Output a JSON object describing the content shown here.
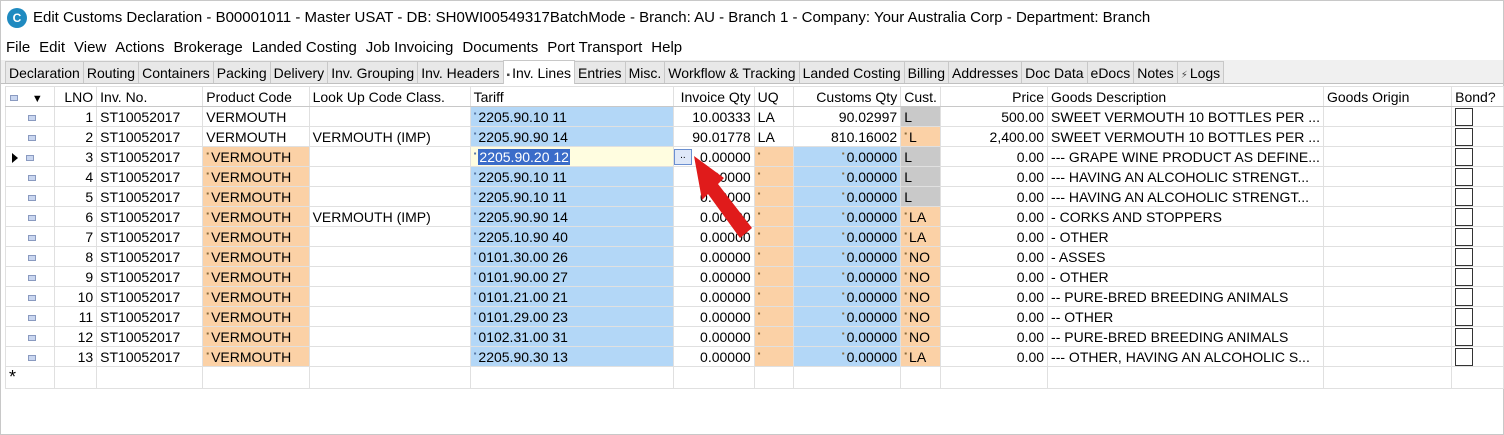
{
  "window": {
    "title": "Edit Customs Declaration - B00001011 - Master USAT - DB: SH0WI00549317BatchMode - Branch: AU - Branch 1 - Company: Your Australia Corp - Department: Branch",
    "app_icon_letter": "C"
  },
  "menu": [
    "File",
    "Edit",
    "View",
    "Actions",
    "Brokerage",
    "Landed Costing",
    "Job Invoicing",
    "Documents",
    "Port Transport",
    "Help"
  ],
  "tabs": [
    {
      "label": "Declaration",
      "active": false
    },
    {
      "label": "Routing",
      "active": false
    },
    {
      "label": "Containers",
      "active": false
    },
    {
      "label": "Packing",
      "active": false
    },
    {
      "label": "Delivery",
      "active": false
    },
    {
      "label": "Inv. Grouping",
      "active": false
    },
    {
      "label": "Inv. Headers",
      "active": false
    },
    {
      "label": "Inv. Lines",
      "active": true
    },
    {
      "label": "Entries",
      "active": false
    },
    {
      "label": "Misc.",
      "active": false
    },
    {
      "label": "Workflow & Tracking",
      "active": false
    },
    {
      "label": "Landed Costing",
      "active": false
    },
    {
      "label": "Billing",
      "active": false
    },
    {
      "label": "Addresses",
      "active": false
    },
    {
      "label": "Doc Data",
      "active": false
    },
    {
      "label": "eDocs",
      "active": false
    },
    {
      "label": "Notes",
      "active": false
    },
    {
      "label": "Logs",
      "active": false
    }
  ],
  "grid": {
    "columns": [
      "LNO",
      "Inv. No.",
      "Product Code",
      "Look Up Code Class.",
      "Tariff",
      "Invoice Qty",
      "UQ",
      "Customs Qty",
      "Cust.",
      "Price",
      "Goods Description",
      "Goods Origin",
      "Bond?"
    ],
    "rows": [
      {
        "lno": "1",
        "inv": "ST10052017",
        "product": "VERMOUTH",
        "lookup": "",
        "tariff": "2205.90.10 11",
        "invqty": "10.00333",
        "uq": "LA",
        "custqty": "90.02997",
        "cust": "L",
        "price": "500.00",
        "desc": "SWEET VERMOUTH 10 BOTTLES PER ...",
        "origin": ""
      },
      {
        "lno": "2",
        "inv": "ST10052017",
        "product": "VERMOUTH",
        "lookup": "VERMOUTH (IMP)",
        "tariff": "2205.90.90 14",
        "invqty": "90.01778",
        "uq": "LA",
        "custqty": "810.16002",
        "cust": "L",
        "price": "2,400.00",
        "desc": "SWEET VERMOUTH 10 BOTTLES PER ...",
        "origin": ""
      },
      {
        "lno": "3",
        "inv": "ST10052017",
        "product": "VERMOUTH",
        "lookup": "",
        "tariff": "2205.90.20 12",
        "invqty": "0.00000",
        "uq": "",
        "custqty": "0.00000",
        "cust": "L",
        "price": "0.00",
        "desc": "--- GRAPE WINE PRODUCT AS DEFINE...",
        "origin": ""
      },
      {
        "lno": "4",
        "inv": "ST10052017",
        "product": "VERMOUTH",
        "lookup": "",
        "tariff": "2205.90.10 11",
        "invqty": "0.00000",
        "uq": "",
        "custqty": "0.00000",
        "cust": "L",
        "price": "0.00",
        "desc": "--- HAVING AN ALCOHOLIC STRENGT...",
        "origin": ""
      },
      {
        "lno": "5",
        "inv": "ST10052017",
        "product": "VERMOUTH",
        "lookup": "",
        "tariff": "2205.90.10 11",
        "invqty": "0.00000",
        "uq": "",
        "custqty": "0.00000",
        "cust": "L",
        "price": "0.00",
        "desc": "--- HAVING AN ALCOHOLIC STRENGT...",
        "origin": ""
      },
      {
        "lno": "6",
        "inv": "ST10052017",
        "product": "VERMOUTH",
        "lookup": "VERMOUTH (IMP)",
        "tariff": "2205.90.90 14",
        "invqty": "0.00000",
        "uq": "",
        "custqty": "0.00000",
        "cust": "LA",
        "price": "0.00",
        "desc": "- CORKS AND STOPPERS",
        "origin": ""
      },
      {
        "lno": "7",
        "inv": "ST10052017",
        "product": "VERMOUTH",
        "lookup": "",
        "tariff": "2205.10.90 40",
        "invqty": "0.00000",
        "uq": "",
        "custqty": "0.00000",
        "cust": "LA",
        "price": "0.00",
        "desc": "- OTHER",
        "origin": ""
      },
      {
        "lno": "8",
        "inv": "ST10052017",
        "product": "VERMOUTH",
        "lookup": "",
        "tariff": "0101.30.00 26",
        "invqty": "0.00000",
        "uq": "",
        "custqty": "0.00000",
        "cust": "NO",
        "price": "0.00",
        "desc": "- ASSES",
        "origin": ""
      },
      {
        "lno": "9",
        "inv": "ST10052017",
        "product": "VERMOUTH",
        "lookup": "",
        "tariff": "0101.90.00 27",
        "invqty": "0.00000",
        "uq": "",
        "custqty": "0.00000",
        "cust": "NO",
        "price": "0.00",
        "desc": "- OTHER",
        "origin": ""
      },
      {
        "lno": "10",
        "inv": "ST10052017",
        "product": "VERMOUTH",
        "lookup": "",
        "tariff": "0101.21.00 21",
        "invqty": "0.00000",
        "uq": "",
        "custqty": "0.00000",
        "cust": "NO",
        "price": "0.00",
        "desc": "-- PURE-BRED BREEDING ANIMALS",
        "origin": ""
      },
      {
        "lno": "11",
        "inv": "ST10052017",
        "product": "VERMOUTH",
        "lookup": "",
        "tariff": "0101.29.00 23",
        "invqty": "0.00000",
        "uq": "",
        "custqty": "0.00000",
        "cust": "NO",
        "price": "0.00",
        "desc": "-- OTHER",
        "origin": ""
      },
      {
        "lno": "12",
        "inv": "ST10052017",
        "product": "VERMOUTH",
        "lookup": "",
        "tariff": "0102.31.00 31",
        "invqty": "0.00000",
        "uq": "",
        "custqty": "0.00000",
        "cust": "NO",
        "price": "0.00",
        "desc": "-- PURE-BRED BREEDING ANIMALS",
        "origin": ""
      },
      {
        "lno": "13",
        "inv": "ST10052017",
        "product": "VERMOUTH",
        "lookup": "",
        "tariff": "2205.90.30 13",
        "invqty": "0.00000",
        "uq": "",
        "custqty": "0.00000",
        "cust": "LA",
        "price": "0.00",
        "desc": "--- OTHER, HAVING AN ALCOHOLIC S...",
        "origin": ""
      }
    ],
    "new_row_marker": "*",
    "ellipsis_label": "..",
    "current_row_index": 2
  },
  "colors": {
    "orange": "#fbd1a6",
    "blue": "#b3d7f7",
    "grey": "#c9c9c9",
    "selection": "#3b6cc9",
    "annotation_arrow": "#e01b1b"
  },
  "icons": [
    "app-icon",
    "row-indicator-icon",
    "current-row-pointer-icon",
    "sort-dropdown-icon",
    "tab-icon",
    "annotation-arrow"
  ]
}
